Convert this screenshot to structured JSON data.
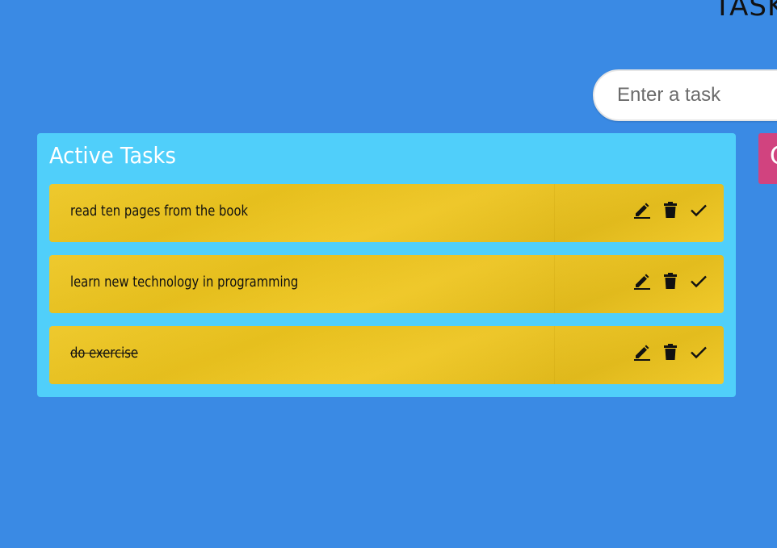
{
  "header": {
    "title": "TASKS"
  },
  "input": {
    "placeholder": "Enter a task"
  },
  "side_tab": {
    "label": "C"
  },
  "panel": {
    "title": "Active Tasks"
  },
  "tasks": [
    {
      "text": "read ten pages from the book",
      "completed": false
    },
    {
      "text": "learn new technology in programming",
      "completed": false
    },
    {
      "text": "do exercise",
      "completed": true
    }
  ],
  "icons": {
    "edit": "edit-icon",
    "delete": "trash-icon",
    "complete": "check-icon"
  },
  "colors": {
    "background": "#3a8ae4",
    "panel": "#50cffa",
    "task_card": "#efc51f",
    "side_tab": "#d1437f"
  }
}
